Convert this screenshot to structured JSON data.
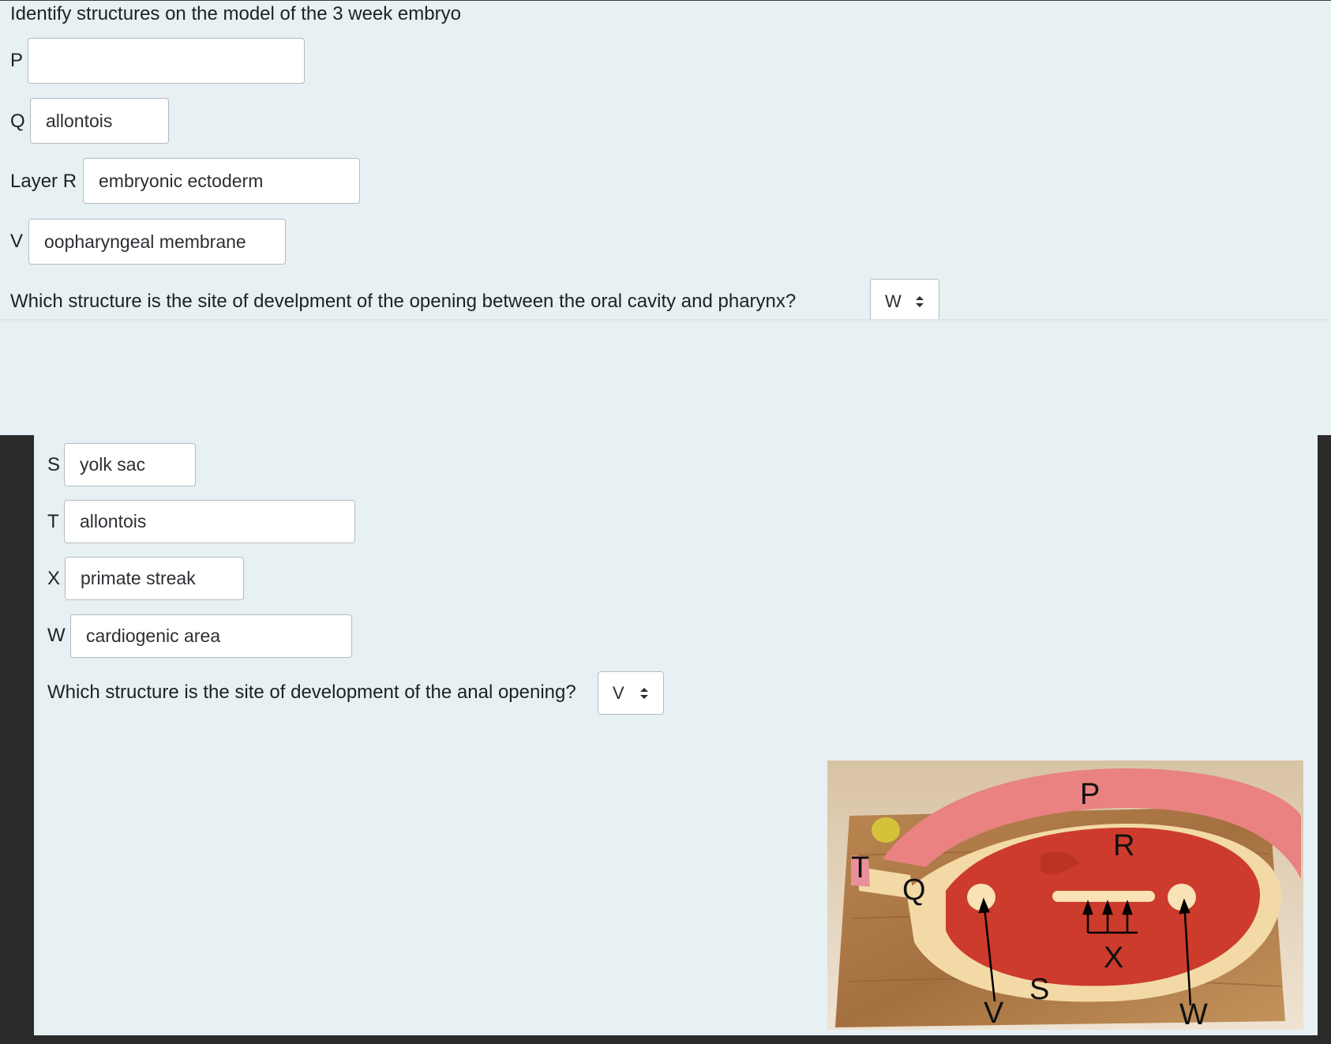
{
  "question": {
    "instruction": "Identify structures on the model of the 3 week embryo",
    "fields_top": [
      {
        "label": "P",
        "value": ""
      },
      {
        "label": "Q",
        "value": "allontois"
      },
      {
        "label": "Layer R",
        "value": "embryonic ectoderm"
      },
      {
        "label": "V",
        "value": "oopharyngeal membrane"
      }
    ],
    "question1": {
      "text": "Which structure is the site of develpment of the opening between the oral cavity and pharynx?",
      "selected": "W"
    },
    "fields_bottom": [
      {
        "label": "S",
        "value": "yolk sac"
      },
      {
        "label": "T",
        "value": "allontois"
      },
      {
        "label": "X",
        "value": "primate streak"
      },
      {
        "label": "W",
        "value": "cardiogenic area"
      }
    ],
    "question2": {
      "text": "Which structure is the site of development of the anal opening?",
      "selected": "V"
    }
  },
  "figure": {
    "labels": {
      "P": "P",
      "R": "R",
      "T": "T",
      "Q": "Q",
      "X": "X",
      "V": "V",
      "S": "S",
      "W": "W"
    }
  },
  "colors": {
    "page_bg": "#e7f0f3",
    "frame": "#2a2a2a"
  }
}
